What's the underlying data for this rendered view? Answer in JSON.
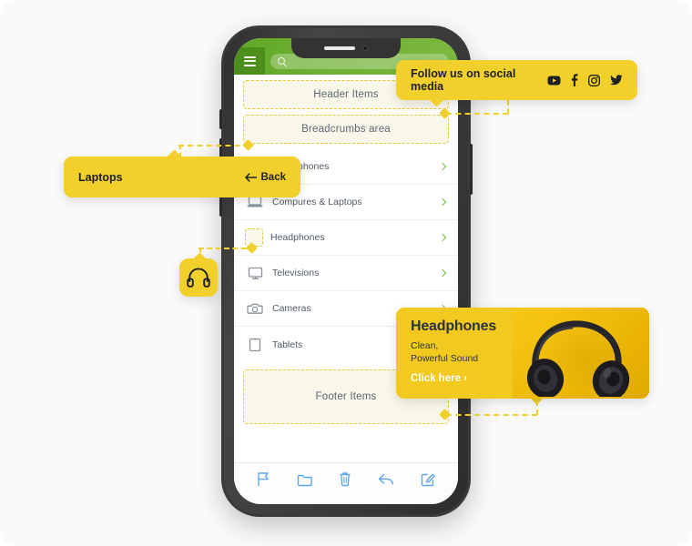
{
  "app": {
    "header": {
      "menu_icon": "hamburger-icon",
      "search_placeholder": "",
      "search_icon": "search-icon"
    },
    "placeholders": {
      "header_items": "Header Items",
      "breadcrumbs": "Breadcrumbs area",
      "footer_items": "Footer Items"
    },
    "categories": [
      {
        "label": "Smartphones",
        "icon": "smartphone-icon",
        "chevron": "chevron-right-icon",
        "highlighted": false
      },
      {
        "label": "Compures & Laptops",
        "icon": "laptop-icon",
        "chevron": "chevron-right-icon",
        "highlighted": false
      },
      {
        "label": "Headphones",
        "icon": "headphones-icon",
        "chevron": "chevron-right-icon",
        "highlighted": true
      },
      {
        "label": "Televisions",
        "icon": "monitor-icon",
        "chevron": "chevron-right-icon",
        "highlighted": false
      },
      {
        "label": "Cameras",
        "icon": "camera-icon",
        "chevron": "chevron-right-icon",
        "highlighted": false
      },
      {
        "label": "Tablets",
        "icon": "tablet-icon",
        "chevron": "chevron-right-icon",
        "highlighted": false
      }
    ],
    "toolbar": [
      {
        "icon": "flag-icon"
      },
      {
        "icon": "folder-icon"
      },
      {
        "icon": "trash-icon"
      },
      {
        "icon": "reply-icon"
      },
      {
        "icon": "compose-icon"
      }
    ]
  },
  "callouts": {
    "social": {
      "text": "Follow us on social media",
      "icons": [
        "youtube-icon",
        "facebook-icon",
        "instagram-icon",
        "twitter-icon"
      ]
    },
    "laptops": {
      "title": "Laptops",
      "back_label": "Back",
      "back_icon": "arrow-left-icon"
    },
    "headphones_badge": {
      "icon": "headphones-icon"
    },
    "product_card": {
      "title": "Headphones",
      "subtitle_line1": "Clean,",
      "subtitle_line2": "Powerful Sound",
      "cta": "Click here ›",
      "photo_alt": "headphones-photo"
    }
  },
  "colors": {
    "accent_yellow": "#f2d02c",
    "card_yellow": "#f2c91f",
    "header_green": "#6fb032",
    "menu_green": "#4d8f1c",
    "dashed_border": "#e8c933",
    "dashed_fill": "#f9f7e9",
    "chevron_green": "#7cb93f",
    "toolbar_blue": "#5ca8f0",
    "text_dark": "#1e2024",
    "text_muted": "#515a66",
    "phone_body": "#3a3a3a",
    "page_bg": "#fafafb"
  }
}
